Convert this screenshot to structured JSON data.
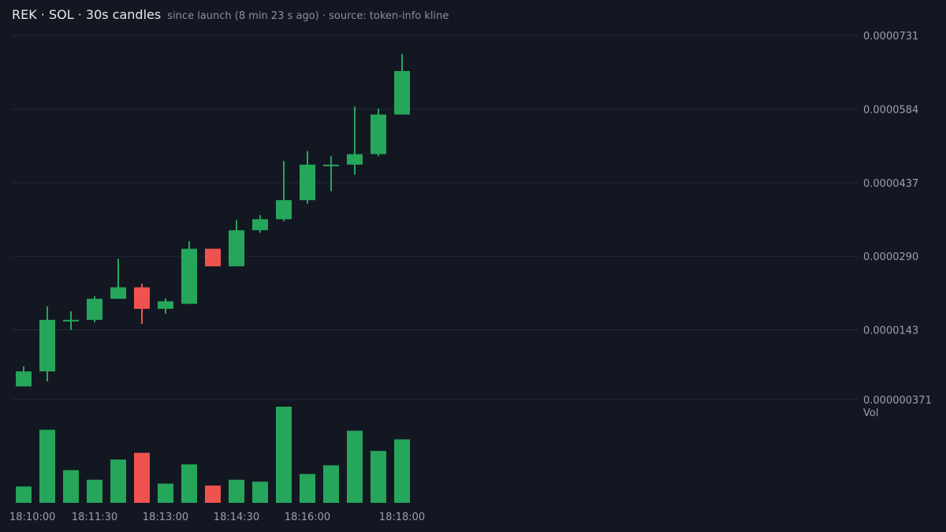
{
  "header": {
    "title": "REK · SOL · 30s candles",
    "subtitle": "since launch (8 min 23 s ago) · source: token-info kline"
  },
  "colors": {
    "background": "#131722",
    "up": "#26a65b",
    "down": "#ef5350",
    "grid": "#242938"
  },
  "chart_data": {
    "type": "candlestick",
    "interval": "30s",
    "y_ticks": [
      "0.0000731",
      "0.0000584",
      "0.0000437",
      "0.0000290",
      "0.0000143",
      "0.000000371"
    ],
    "volume_label": "Vol",
    "x_ticks": [
      "18:10:00",
      "18:11:30",
      "18:13:00",
      "18:14:30",
      "18:16:00",
      "18:18:00"
    ],
    "candles": [
      {
        "t": "18:10:00",
        "o": 3e-06,
        "h": 7e-06,
        "l": 3e-06,
        "c": 6e-06,
        "v": 0.17
      },
      {
        "t": "18:10:30",
        "o": 6e-06,
        "h": 1.9e-05,
        "l": 4e-06,
        "c": 1.63e-05,
        "v": 0.76
      },
      {
        "t": "18:11:00",
        "o": 1.63e-05,
        "h": 1.8e-05,
        "l": 1.43e-05,
        "c": 1.63e-05,
        "v": 0.34
      },
      {
        "t": "18:11:30",
        "o": 1.63e-05,
        "h": 2.1e-05,
        "l": 1.58e-05,
        "c": 2.05e-05,
        "v": 0.24
      },
      {
        "t": "18:12:00",
        "o": 2.05e-05,
        "h": 2.85e-05,
        "l": 2.05e-05,
        "c": 2.28e-05,
        "v": 0.45
      },
      {
        "t": "18:12:30",
        "o": 2.28e-05,
        "h": 2.35e-05,
        "l": 1.55e-05,
        "c": 1.85e-05,
        "v": 0.52
      },
      {
        "t": "18:13:00",
        "o": 1.85e-05,
        "h": 2.06e-05,
        "l": 1.75e-05,
        "c": 2e-05,
        "v": 0.2
      },
      {
        "t": "18:13:30",
        "o": 1.95e-05,
        "h": 3.2e-05,
        "l": 1.95e-05,
        "c": 3.05e-05,
        "v": 0.4
      },
      {
        "t": "18:14:00",
        "o": 3.05e-05,
        "h": 3.05e-05,
        "l": 2.7e-05,
        "c": 2.7e-05,
        "v": 0.18
      },
      {
        "t": "18:14:30",
        "o": 2.7e-05,
        "h": 3.62e-05,
        "l": 2.7e-05,
        "c": 3.42e-05,
        "v": 0.24
      },
      {
        "t": "18:15:00",
        "o": 3.42e-05,
        "h": 3.72e-05,
        "l": 3.37e-05,
        "c": 3.64e-05,
        "v": 0.22
      },
      {
        "t": "18:15:30",
        "o": 3.64e-05,
        "h": 4.8e-05,
        "l": 3.6e-05,
        "c": 4.02e-05,
        "v": 1.0
      },
      {
        "t": "18:16:00",
        "o": 4.02e-05,
        "h": 5e-05,
        "l": 3.95e-05,
        "c": 4.73e-05,
        "v": 0.3
      },
      {
        "t": "18:16:30",
        "o": 4.73e-05,
        "h": 4.9e-05,
        "l": 4.2e-05,
        "c": 4.73e-05,
        "v": 0.39
      },
      {
        "t": "18:17:00",
        "o": 4.73e-05,
        "h": 5.89e-05,
        "l": 4.53e-05,
        "c": 4.94e-05,
        "v": 0.75
      },
      {
        "t": "18:17:30",
        "o": 4.94e-05,
        "h": 5.85e-05,
        "l": 4.9e-05,
        "c": 5.73e-05,
        "v": 0.54
      },
      {
        "t": "18:18:00",
        "o": 5.73e-05,
        "h": 6.94e-05,
        "l": 5.73e-05,
        "c": 6.6e-05,
        "v": 0.66
      }
    ]
  }
}
